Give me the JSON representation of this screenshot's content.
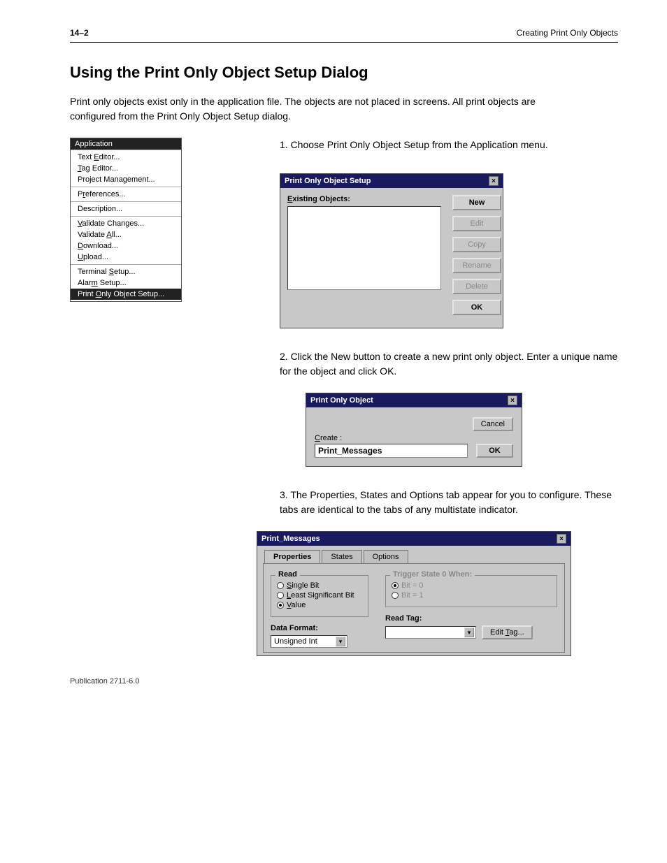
{
  "header": {
    "chapter": "14–2",
    "title": "Creating Print Only Objects"
  },
  "h1": "Using the Print Only Object Setup Dialog",
  "intro": "Print only objects exist only in the application file. The objects are not placed in screens. All print objects are configured from the Print Only Object Setup dialog.",
  "step1": "1. Choose Print Only Object Setup from the Application menu.",
  "menu": {
    "title": "Application",
    "groups": [
      [
        "Text Editor...",
        "Tag Editor...",
        "Project Management..."
      ],
      [
        "Preferences..."
      ],
      [
        "Description..."
      ],
      [
        "Validate Changes...",
        "Validate All...",
        "Download...",
        "Upload..."
      ],
      [
        "Terminal Setup...",
        "Alarm Setup...",
        "Print Only Object Setup..."
      ]
    ],
    "selected": "Print Only Object Setup..."
  },
  "setup_dlg": {
    "title": "Print Only Object Setup",
    "list_label": "Existing Objects:",
    "buttons": {
      "new": "New",
      "edit": "Edit",
      "copy": "Copy",
      "rename": "Rename",
      "delete": "Delete",
      "ok": "OK"
    }
  },
  "step2": "2. Click the New button to create a new print only object. Enter a unique name for the object and click OK.",
  "create_dlg": {
    "title": "Print Only Object",
    "create_label": "Create :",
    "value": "Print_Messages",
    "ok": "OK",
    "cancel": "Cancel"
  },
  "step3": "3. The Properties, States and Options tab appear for you to configure. These tabs are identical to the tabs of any multistate indicator.",
  "props_dlg": {
    "title": "Print_Messages",
    "tabs": {
      "properties": "Properties",
      "states": "States",
      "options": "Options"
    },
    "read_label": "Read",
    "read_opts": {
      "single": "Single Bit",
      "lsb": "Least Significant Bit",
      "value": "Value"
    },
    "trigger_label": "Trigger State 0 When:",
    "trigger_opts": {
      "bit0": "Bit = 0",
      "bit1": "Bit = 1"
    },
    "data_format_label": "Data Format:",
    "data_format_value": "Unsigned Int",
    "read_tag_label": "Read Tag:",
    "read_tag_value": "",
    "edit_tag": "Edit Tag..."
  },
  "footer": "Publication 2711-6.0"
}
